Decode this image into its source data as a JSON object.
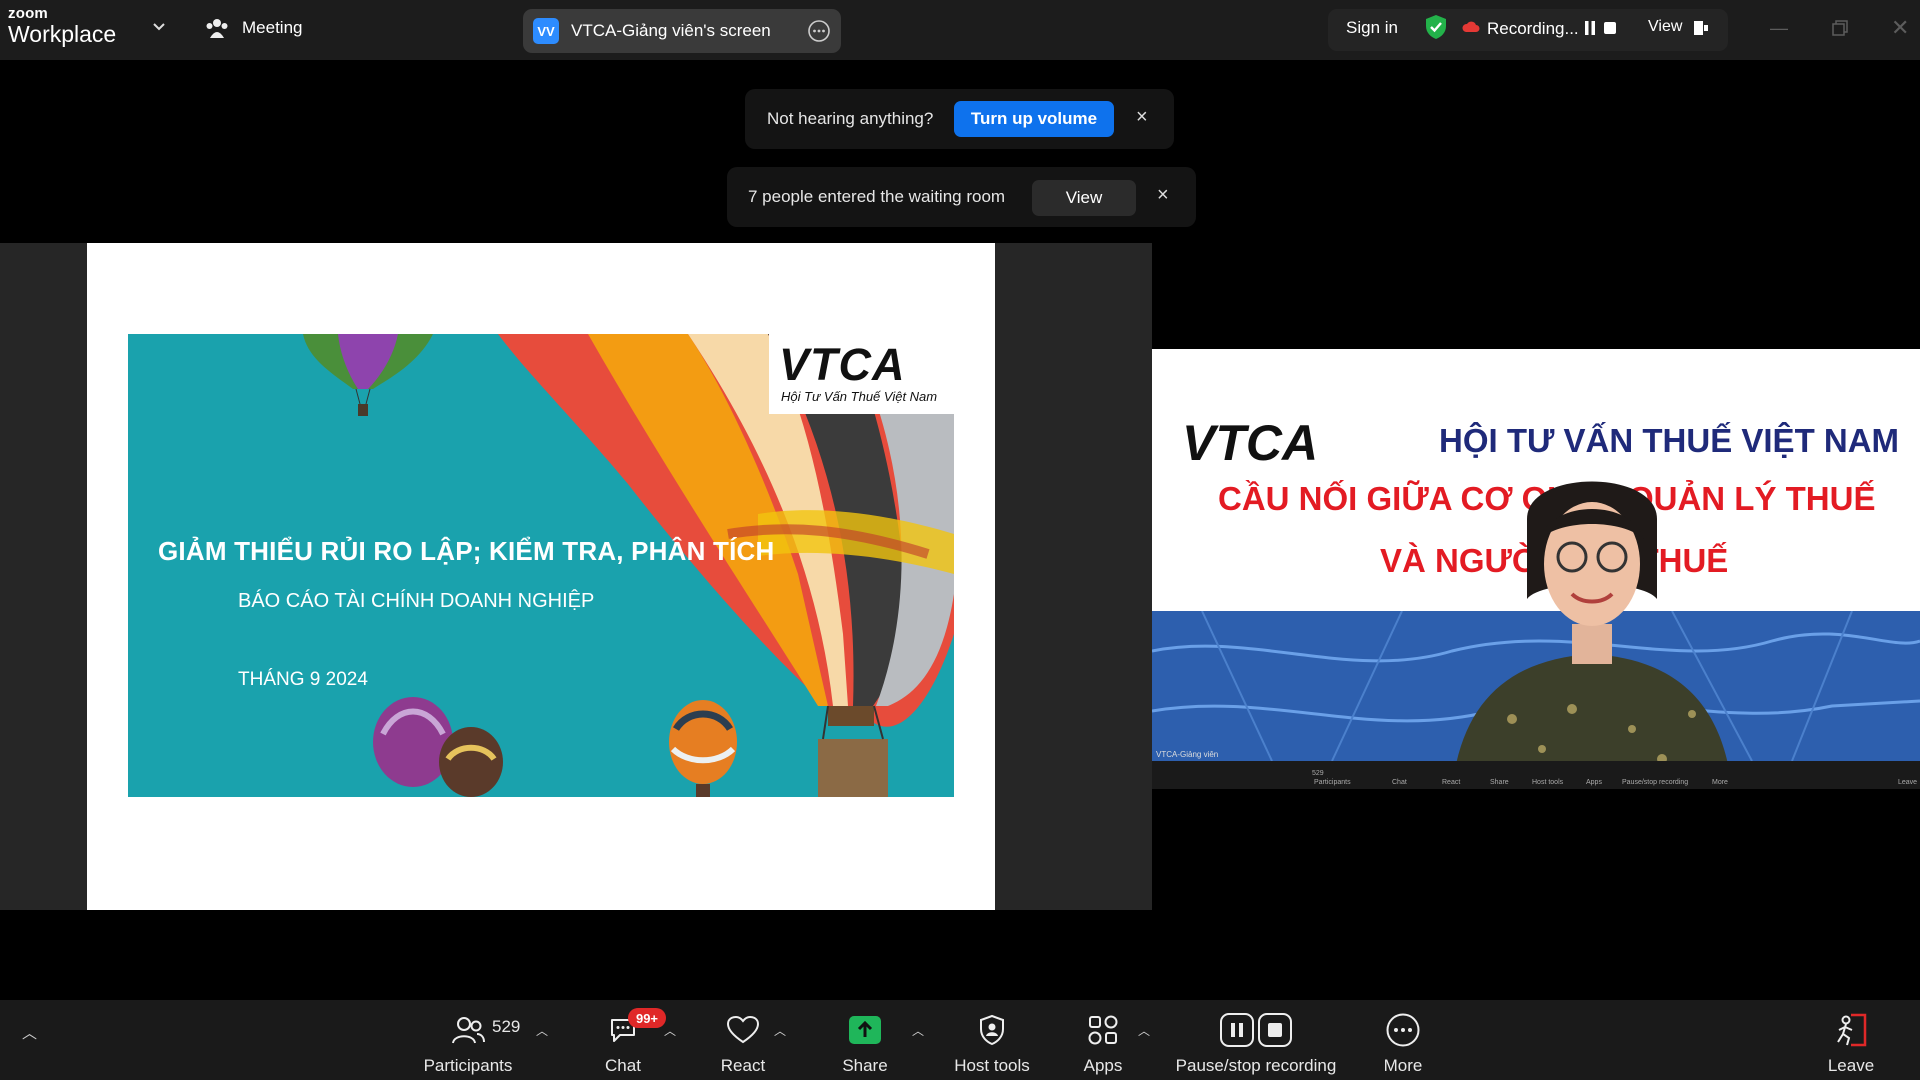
{
  "app": {
    "brand_small": "zoom",
    "brand_big": "Workplace",
    "meeting_label": "Meeting"
  },
  "share_pill": {
    "initials": "VV",
    "title": "VTCA-Giảng viên's screen"
  },
  "header_right": {
    "sign_in": "Sign in",
    "recording": "Recording...",
    "view": "View"
  },
  "notifications": {
    "audio": {
      "text": "Not hearing anything?",
      "button": "Turn up volume",
      "close": "×"
    },
    "waiting": {
      "text": "7 people entered the waiting room",
      "button": "View",
      "close": "×"
    }
  },
  "slide": {
    "logo": "VTCA",
    "logo_tagline": "Hội Tư Vấn Thuế Việt Nam",
    "title": "GIẢM THIỂU  RỦI RO LẬP; KIỂM TRA, PHÂN TÍCH",
    "subtitle": "BÁO CÁO TÀI CHÍNH DOANH NGHIỆP",
    "date": "THÁNG 9 2024"
  },
  "video": {
    "banner_logo": "VTCA",
    "banner_line1": "HỘI TƯ VẤN THUẾ VIỆT NAM",
    "banner_line2": "CẦU NỐI GIỮA CƠ QUAN QUẢN LÝ THUẾ",
    "banner_line3": "VÀ NGƯỜI NỘP THUẾ",
    "participant_name": "VTCA-Giảng viên",
    "mini_toolbar": [
      "529",
      "Participants",
      "Chat",
      "React",
      "Share",
      "Host tools",
      "Apps",
      "Pause/stop recording",
      "More",
      "Leave"
    ]
  },
  "toolbar": {
    "participants_count": "529",
    "chat_badge": "99+",
    "items": {
      "participants": "Participants",
      "chat": "Chat",
      "react": "React",
      "share": "Share",
      "host_tools": "Host tools",
      "apps": "Apps",
      "pause_stop": "Pause/stop recording",
      "more": "More",
      "leave": "Leave"
    }
  },
  "colors": {
    "accent_blue": "#0e72ed",
    "share_green": "#1fb65a",
    "leave_red": "#e02828",
    "shield_green": "#23b24a"
  }
}
